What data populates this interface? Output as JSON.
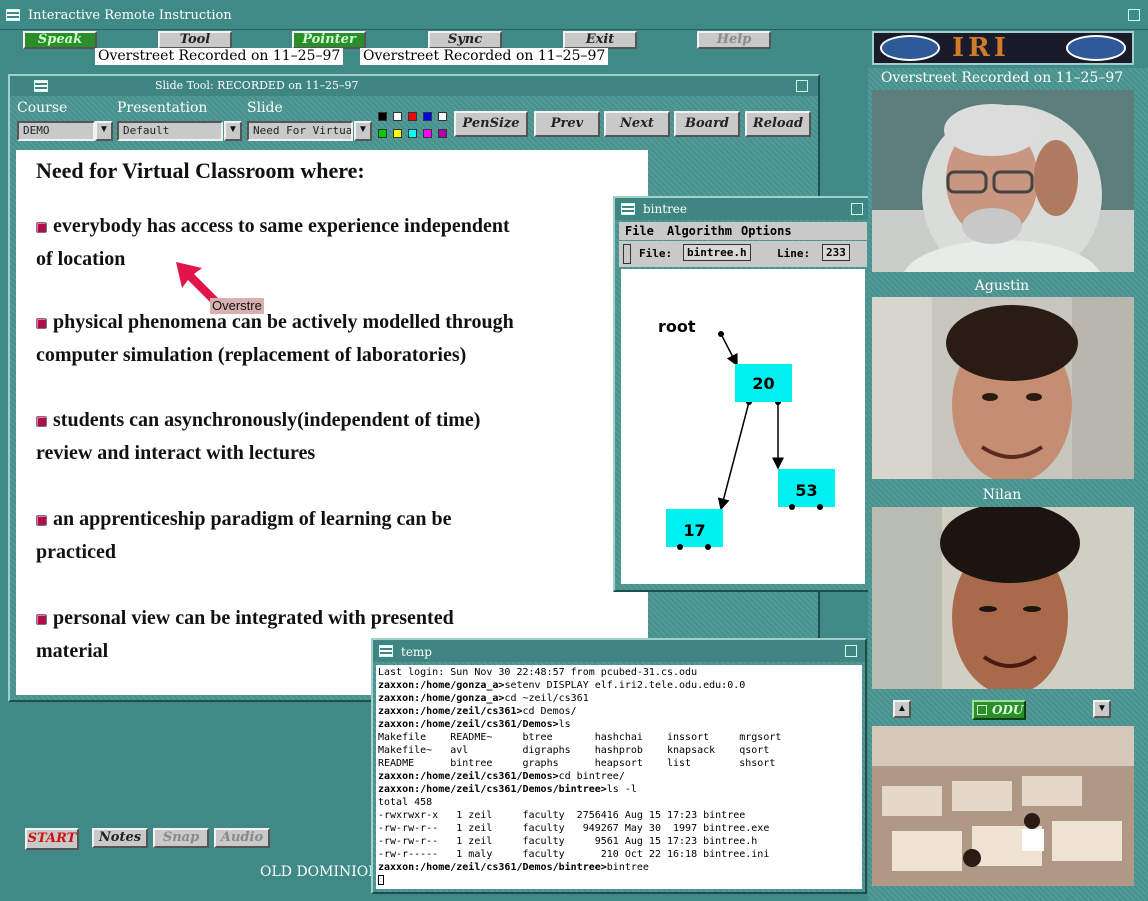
{
  "app": {
    "title": "Interactive Remote Instruction",
    "footer_text": "OLD DOMINION"
  },
  "toolbar": {
    "speak": "Speak",
    "tool": "Tool",
    "pointer": "Pointer",
    "sync": "Sync",
    "exit": "Exit",
    "help": "Help",
    "recorded_left": "Overstreet  Recorded on 11–25–97",
    "recorded_right": "Overstreet  Recorded on 11–25–97"
  },
  "logo": {
    "text": "IRI"
  },
  "slide_tool": {
    "title": "Slide Tool:  RECORDED on 11–25–97",
    "labels": {
      "course": "Course",
      "presentation": "Presentation",
      "slide": "Slide"
    },
    "course_value": "DEMO",
    "presentation_value": "Default",
    "slide_value": "Need For Virtua",
    "buttons": {
      "pensize": "PenSize",
      "prev": "Prev",
      "next": "Next",
      "board": "Board",
      "reload": "Reload"
    },
    "colors": [
      "#000000",
      "#ffffff",
      "#ff0000",
      "#0000ff",
      "#ffffff",
      "#00cc00",
      "#ffff00",
      "#00ffff",
      "#ff00ff",
      "#b000b0"
    ],
    "slide": {
      "heading": "Need for Virtual Classroom where:",
      "bullets": [
        {
          "line1": "everybody has access to same experience independent",
          "line2": "of location"
        },
        {
          "line1": "physical phenomena can be actively modelled through",
          "line2": "computer simulation (replacement of laboratories)"
        },
        {
          "line1": "students can asynchronously(independent of time)",
          "line2": "review and interact with lectures"
        },
        {
          "line1": "an apprenticeship paradigm of learning can be",
          "line2": "practiced"
        },
        {
          "line1": "personal view can be integrated with presented",
          "line2": "material"
        }
      ],
      "pointer_label": "Overstre"
    },
    "bottom_buttons": {
      "start": "START",
      "notes": "Notes",
      "snap": "Snap",
      "audio": "Audio"
    }
  },
  "bintree": {
    "title": "bintree",
    "menu": [
      "File",
      "Algorithm",
      "Options"
    ],
    "file_label": "File:",
    "file_value": "bintree.h",
    "line_label": "Line:",
    "line_value": "233",
    "root_label": "root",
    "nodes": {
      "root": "20",
      "right": "53",
      "left": "17"
    }
  },
  "terminal": {
    "title": "temp",
    "lines": [
      {
        "prompt": "",
        "text": "Last login: Sun Nov 30 22:48:57 from pcubed-31.cs.odu"
      },
      {
        "prompt": "zaxxon:/home/gonza_a>",
        "text": "setenv DISPLAY elf.iri2.tele.odu.edu:0.0"
      },
      {
        "prompt": "zaxxon:/home/gonza_a>",
        "text": "cd ~zeil/cs361"
      },
      {
        "prompt": "zaxxon:/home/zeil/cs361>",
        "text": "cd Demos/"
      },
      {
        "prompt": "zaxxon:/home/zeil/cs361/Demos>",
        "text": "ls"
      },
      {
        "prompt": "",
        "text": "Makefile    README~     btree       hashchai    inssort     mrgsort"
      },
      {
        "prompt": "",
        "text": "Makefile~   avl         digraphs    hashprob    knapsack    qsort"
      },
      {
        "prompt": "",
        "text": "README      bintree     graphs      heapsort    list        shsort"
      },
      {
        "prompt": "zaxxon:/home/zeil/cs361/Demos>",
        "text": "cd bintree/"
      },
      {
        "prompt": "zaxxon:/home/zeil/cs361/Demos/bintree>",
        "text": "ls -l"
      },
      {
        "prompt": "",
        "text": "total 458"
      },
      {
        "prompt": "",
        "text": "-rwxrwxr-x   1 zeil     faculty  2756416 Aug 15 17:23 bintree"
      },
      {
        "prompt": "",
        "text": "-rw-rw-r--   1 zeil     faculty   949267 May 30  1997 bintree.exe"
      },
      {
        "prompt": "",
        "text": "-rw-rw-r--   1 zeil     faculty     9561 Aug 15 17:23 bintree.h"
      },
      {
        "prompt": "",
        "text": "-rw-r-----   1 maly     faculty      210 Oct 22 16:18 bintree.ini"
      },
      {
        "prompt": "zaxxon:/home/zeil/cs361/Demos/bintree>",
        "text": "bintree"
      }
    ]
  },
  "video_panel": {
    "feed1_label": "Overstreet  Recorded on 11–25–97",
    "feed2_label": "Agustin",
    "feed3_label": "Nilan",
    "room_selector": "ODU"
  }
}
